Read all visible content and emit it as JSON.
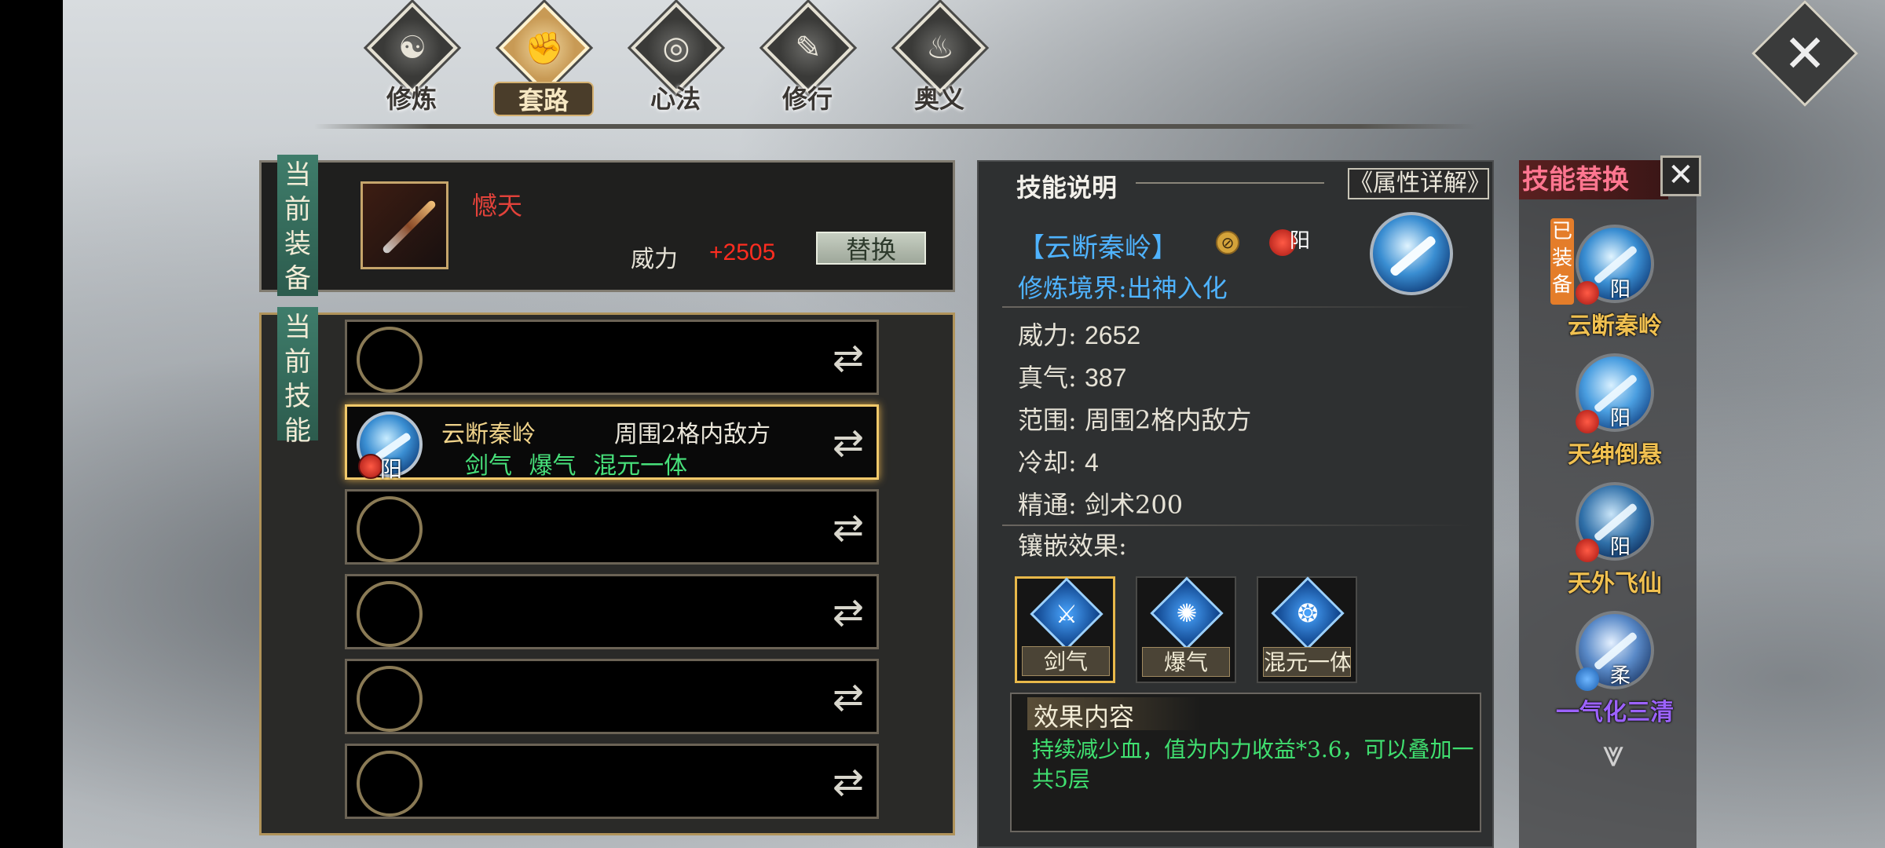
{
  "tabs": [
    {
      "label": "修炼",
      "icon": "lotus-icon",
      "glyph": "☯"
    },
    {
      "label": "套路",
      "icon": "fist-icon",
      "glyph": "✊"
    },
    {
      "label": "心法",
      "icon": "swirl-icon",
      "glyph": "◎"
    },
    {
      "label": "修行",
      "icon": "scroll-icon",
      "glyph": "✎"
    },
    {
      "label": "奥义",
      "icon": "flame-icon",
      "glyph": "♨"
    }
  ],
  "active_tab": "套路",
  "equipment": {
    "tag": "当前装备",
    "weapon_name": "憾天",
    "power_label": "威力",
    "power_value": "+2505",
    "replace_label": "替换"
  },
  "skills_panel": {
    "tag": "当前技能",
    "slots": [
      {
        "empty": true
      },
      {
        "empty": false,
        "name": "云断秦岭",
        "range": "周围2格内敌方",
        "tags": "剑气 爆气 混元一体",
        "gem": "阳"
      },
      {
        "empty": true
      },
      {
        "empty": true
      },
      {
        "empty": true
      },
      {
        "empty": true
      }
    ]
  },
  "description": {
    "title": "技能说明",
    "attr_button": "《属性详解》",
    "skill_name": "【云断秦岭】",
    "gem_label": "阳",
    "realm": "修炼境界:出神入化",
    "stats": [
      {
        "label": "威力:",
        "value": "2652"
      },
      {
        "label": "真气:",
        "value": "387"
      },
      {
        "label": "范围:",
        "value": "周围2格内敌方"
      },
      {
        "label": "冷却:",
        "value": "4"
      },
      {
        "label": "精通:",
        "value": "剑术200"
      }
    ],
    "inlay_title": "镶嵌效果:",
    "inlays": [
      {
        "label": "剑气",
        "icon": "sword-energy-icon",
        "glyph": "⚔"
      },
      {
        "label": "爆气",
        "icon": "burst-icon",
        "glyph": "✺"
      },
      {
        "label": "混元一体",
        "icon": "unity-icon",
        "glyph": "❂"
      }
    ],
    "effect_title": "效果内容",
    "effect_text": "持续减少血，值为内力收益*3.6，可以叠加一共5层"
  },
  "replace_column": {
    "title": "技能替换",
    "equipped_badge": "已装备",
    "skills": [
      {
        "name": "云断秦岭",
        "gem": "阳",
        "color": "#3a8ed2"
      },
      {
        "name": "天绅倒悬",
        "gem": "阳",
        "color": "#4a9ee0"
      },
      {
        "name": "天外飞仙",
        "gem": "阳",
        "color": "#2f6fa8"
      },
      {
        "name": "一气化三清",
        "gem": "柔",
        "color": "#5a8ac8"
      }
    ]
  }
}
